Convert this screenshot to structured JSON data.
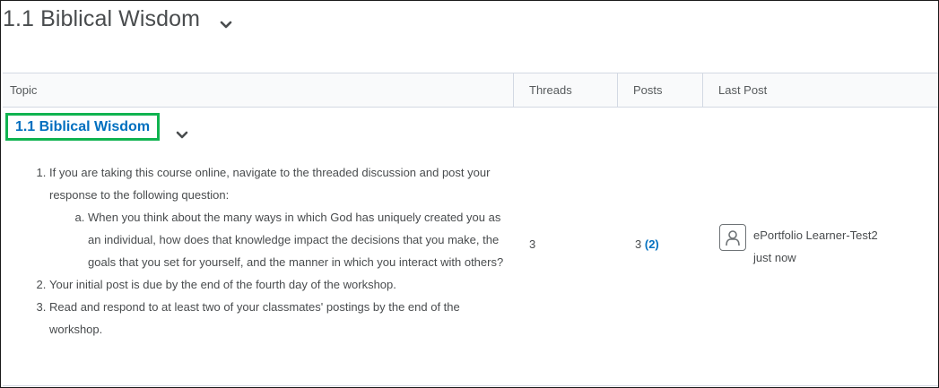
{
  "forum": {
    "title": "1.1 Biblical Wisdom"
  },
  "table": {
    "headers": {
      "topic": "Topic",
      "threads": "Threads",
      "posts": "Posts",
      "last_post": "Last Post"
    },
    "row": {
      "topic_title": "1.1 Biblical Wisdom",
      "description": {
        "item1": "If you are taking this course online, navigate to the threaded discussion and post your response to the following question:",
        "item1a": "When you think about the many ways in which God has uniquely created you as an individual, how does that knowledge impact the decisions that you make, the goals that you set for yourself, and the manner in which you interact with others?",
        "item2": "Your initial post is due by the end of the fourth day of the workshop.",
        "item3": "Read and respond to at least two of your classmates' postings by the end of the workshop."
      },
      "threads": "3",
      "posts": "3",
      "posts_unread": "(2)",
      "last_post_author": "ePortfolio Learner-Test2",
      "last_post_time": "just now"
    }
  },
  "colors": {
    "link": "#006fbf",
    "highlight": "#10b350",
    "text": "#494c4e"
  },
  "icons": {
    "collapse": "chevron-down-icon",
    "avatar": "user-avatar-icon"
  }
}
